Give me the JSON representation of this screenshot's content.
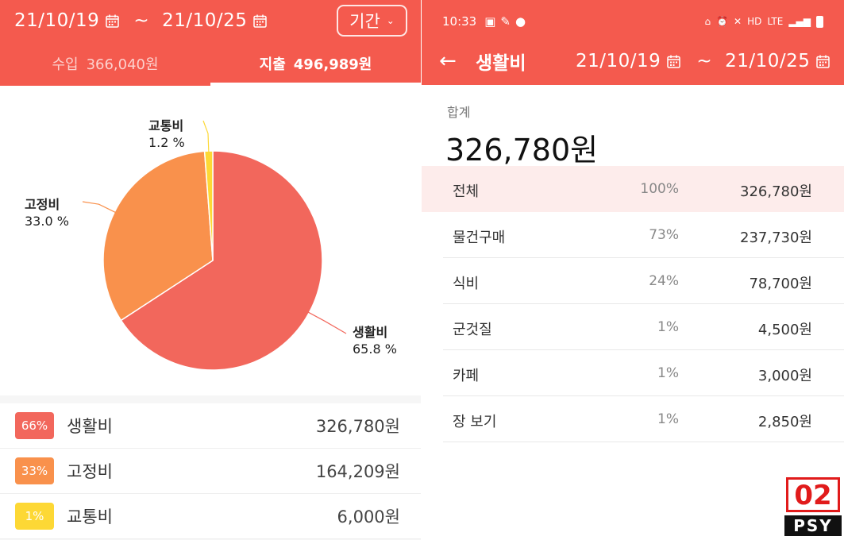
{
  "left": {
    "date_start": "21/10/19",
    "date_end": "21/10/25",
    "tilde": "~",
    "period_button": "기간",
    "income_label": "수입",
    "income_amount": "366,040원",
    "expense_label": "지출",
    "expense_amount": "496,989원",
    "pie_labels": [
      {
        "name": "교통비",
        "pct": "1.2 %"
      },
      {
        "name": "고정비",
        "pct": "33.0 %"
      },
      {
        "name": "생활비",
        "pct": "65.8 %"
      }
    ],
    "categories": [
      {
        "badge": "66%",
        "name": "생활비",
        "amount": "326,780원",
        "color": "#f2675c"
      },
      {
        "badge": "33%",
        "name": "고정비",
        "amount": "164,209원",
        "color": "#f9914c"
      },
      {
        "badge": "1%",
        "name": "교통비",
        "amount": "6,000원",
        "color": "#fdd835"
      }
    ]
  },
  "chart_data": {
    "type": "pie",
    "title": "",
    "slices": [
      {
        "label": "생활비",
        "value": 65.8,
        "color": "#f2675c"
      },
      {
        "label": "고정비",
        "value": 33.0,
        "color": "#f9914c"
      },
      {
        "label": "교통비",
        "value": 1.2,
        "color": "#fdd835"
      }
    ]
  },
  "right": {
    "status_time": "10:33",
    "status_hd": "HD",
    "status_lte": "LTE",
    "back_label": "←",
    "title": "생활비",
    "date_start": "21/10/19",
    "date_end": "21/10/25",
    "tilde": "~",
    "total_label": "합계",
    "total_amount": "326,780원",
    "rows": [
      {
        "name": "전체",
        "pct": "100%",
        "amount": "326,780원"
      },
      {
        "name": "물건구매",
        "pct": "73%",
        "amount": "237,730원"
      },
      {
        "name": "식비",
        "pct": "24%",
        "amount": "78,700원"
      },
      {
        "name": "군것질",
        "pct": "1%",
        "amount": "4,500원"
      },
      {
        "name": "카페",
        "pct": "1%",
        "amount": "3,000원"
      },
      {
        "name": "장 보기",
        "pct": "1%",
        "amount": "2,850원"
      }
    ]
  },
  "logo": {
    "top": "02",
    "bottom": "PSY"
  }
}
